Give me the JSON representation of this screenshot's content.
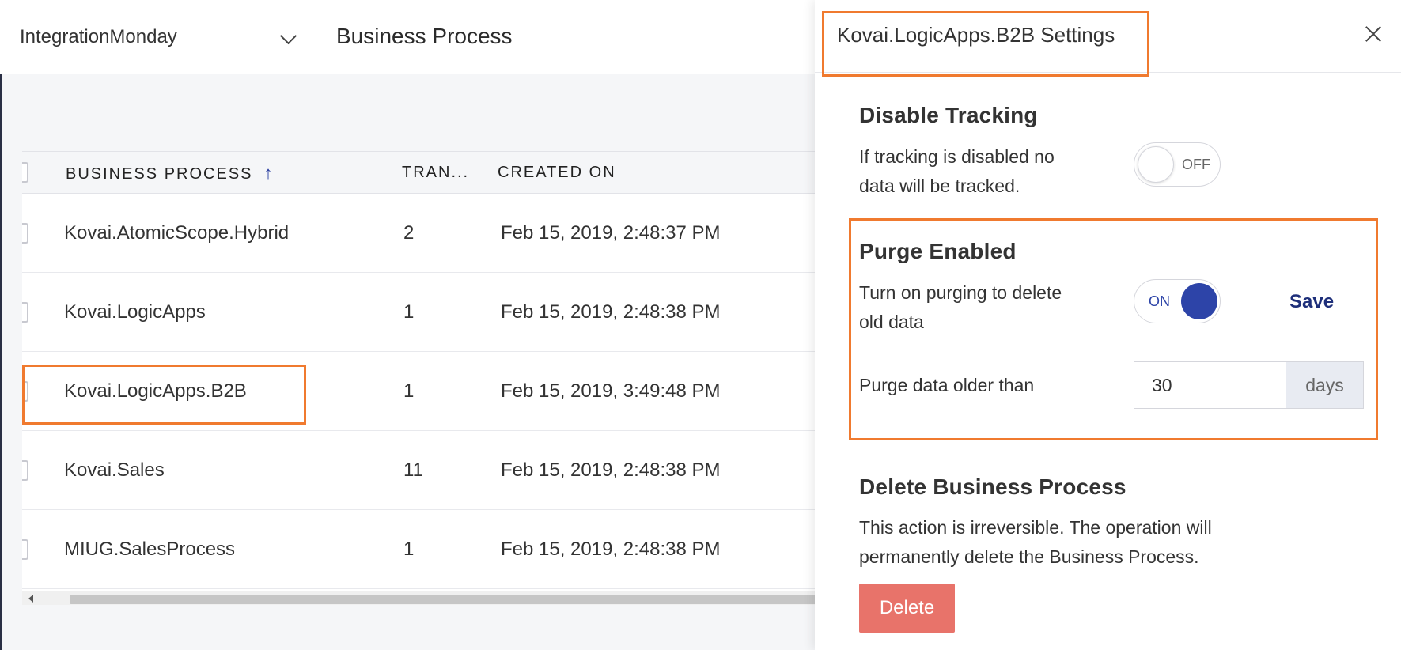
{
  "topbar": {
    "environment": "IntegrationMonday",
    "page_title": "Business Process"
  },
  "table": {
    "columns": [
      "BUSINESS PROCESS",
      "TRAN...",
      "CREATED ON"
    ],
    "sort_indicator": "↑",
    "rows": [
      {
        "name": "Kovai.AtomicScope.Hybrid",
        "transactions": "2",
        "created_on": "Feb 15, 2019, 2:48:37 PM"
      },
      {
        "name": "Kovai.LogicApps",
        "transactions": "1",
        "created_on": "Feb 15, 2019, 2:48:38 PM"
      },
      {
        "name": "Kovai.LogicApps.B2B",
        "transactions": "1",
        "created_on": "Feb 15, 2019, 3:49:48 PM"
      },
      {
        "name": "Kovai.Sales",
        "transactions": "11",
        "created_on": "Feb 15, 2019, 2:48:38 PM"
      },
      {
        "name": "MIUG.SalesProcess",
        "transactions": "1",
        "created_on": "Feb 15, 2019, 2:48:38 PM"
      }
    ]
  },
  "panel": {
    "title": "Kovai.LogicApps.B2B Settings",
    "disable_tracking": {
      "title": "Disable Tracking",
      "desc_line1": "If tracking is disabled no",
      "desc_line2": "data will be tracked.",
      "toggle_label": "OFF"
    },
    "purge": {
      "title": "Purge Enabled",
      "desc_line1": "Turn on purging to delete",
      "desc_line2": "old data",
      "toggle_label": "ON",
      "save_label": "Save",
      "older_than_label": "Purge data older than",
      "days_value": "30",
      "days_unit": "days"
    },
    "delete": {
      "title": "Delete Business Process",
      "desc_line1": "This action is irreversible. The operation will",
      "desc_line2": "permanently delete the Business Process.",
      "button_label": "Delete"
    }
  },
  "colors": {
    "highlight": "#f07a2f",
    "accent": "#2d44a8",
    "delete": "#e8736a"
  }
}
